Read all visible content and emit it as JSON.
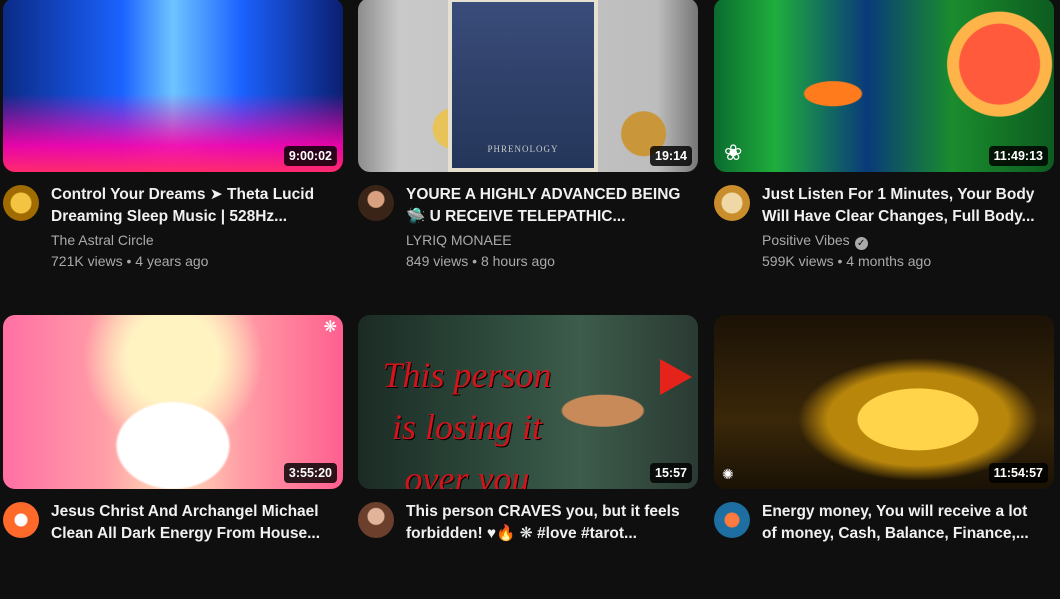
{
  "videos": [
    {
      "title": "Control Your Dreams ➤ Theta Lucid Dreaming Sleep Music | 528Hz...",
      "channel": "The Astral Circle",
      "verified": false,
      "views": "721K views",
      "age": "4 years ago",
      "duration": "9:00:02"
    },
    {
      "title": "YOURE A HIGHLY ADVANCED BEING 🛸 U RECEIVE TELEPATHIC...",
      "channel": "LYRIQ MONAEE",
      "verified": false,
      "views": "849 views",
      "age": "8 hours ago",
      "duration": "19:14",
      "thumb_card_label": "PHRENOLOGY"
    },
    {
      "title": "Just Listen For 1 Minutes, Your Body Will Have Clear Changes, Full Body...",
      "channel": "Positive Vibes",
      "verified": true,
      "views": "599K views",
      "age": "4 months ago",
      "duration": "11:49:13"
    },
    {
      "title": "Jesus Christ And Archangel Michael Clean All Dark Energy From House...",
      "channel": "",
      "verified": false,
      "views": "",
      "age": "",
      "duration": "3:55:20"
    },
    {
      "title": "This person CRAVES you, but it feels forbidden! ♥🔥 ❋ #love #tarot...",
      "channel": "",
      "verified": false,
      "views": "",
      "age": "",
      "duration": "15:57",
      "thumb_text": "This person is losing it over you"
    },
    {
      "title": "Energy money, You will receive a lot of money, Cash, Balance, Finance,...",
      "channel": "",
      "verified": false,
      "views": "",
      "age": "",
      "duration": "11:54:57"
    }
  ]
}
